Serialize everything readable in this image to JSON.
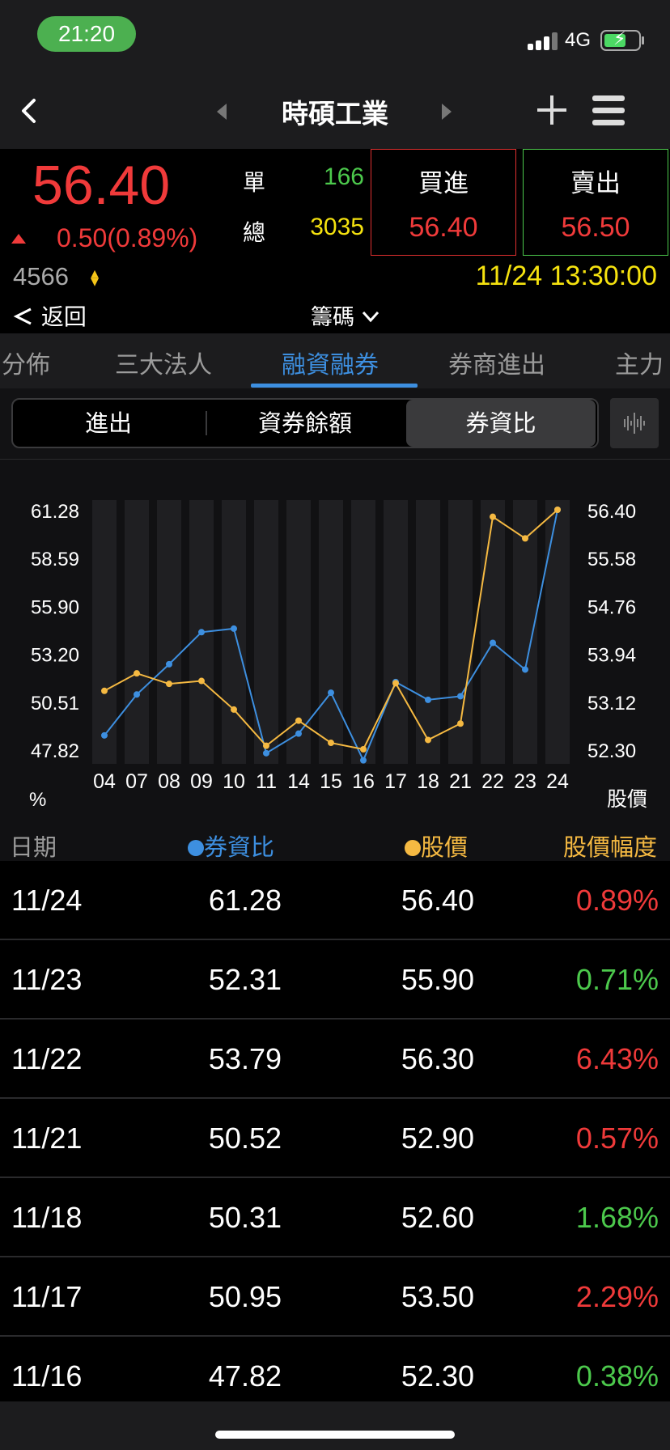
{
  "status_bar": {
    "time": "21:20",
    "network": "4G"
  },
  "nav": {
    "title": "時碩工業"
  },
  "quote": {
    "price": "56.40",
    "change": "0.50",
    "change_pct": "(0.89%)",
    "single_label": "單",
    "single_value": "166",
    "total_label": "總",
    "total_value": "3035",
    "bid_label": "買進",
    "bid_price": "56.40",
    "ask_label": "賣出",
    "ask_price": "56.50",
    "code": "4566",
    "datetime": "11/24 13:30:00",
    "back_label": "返回",
    "chips_label": "籌碼"
  },
  "colors": {
    "up": "#f03a3a",
    "down": "#4cc94c",
    "accent": "#3d8fe0",
    "orange": "#f5b942",
    "yellow": "#f5e20f",
    "green_box": "#4cc94c"
  },
  "tabs": [
    "分佈",
    "三大法人",
    "融資融券",
    "券商進出",
    "主力"
  ],
  "active_tab": 2,
  "segments": [
    "進出",
    "資券餘額",
    "券資比"
  ],
  "active_segment": 2,
  "chart_data": {
    "type": "line",
    "categories": [
      "04",
      "07",
      "08",
      "09",
      "10",
      "11",
      "14",
      "15",
      "16",
      "17",
      "18",
      "21",
      "22",
      "23",
      "24"
    ],
    "series": [
      {
        "name": "券資比",
        "axis": "left",
        "color": "#3d8fe0",
        "values": [
          48.6,
          50.9,
          52.6,
          54.4,
          54.6,
          47.6,
          48.7,
          51.0,
          47.2,
          51.6,
          50.6,
          50.8,
          53.8,
          52.3,
          61.28
        ]
      },
      {
        "name": "股價",
        "axis": "right",
        "color": "#f5b942",
        "values": [
          53.3,
          53.6,
          53.42,
          53.47,
          52.98,
          52.36,
          52.79,
          52.41,
          52.3,
          53.43,
          52.46,
          52.74,
          56.28,
          55.91,
          56.4
        ]
      }
    ],
    "y_left_ticks": [
      "61.28",
      "58.59",
      "55.90",
      "53.20",
      "50.51",
      "47.82"
    ],
    "y_right_ticks": [
      "56.40",
      "55.58",
      "54.76",
      "53.94",
      "53.12",
      "52.30"
    ],
    "ylim_left": [
      47.82,
      61.28
    ],
    "ylim_right": [
      52.3,
      56.4
    ],
    "y_left_unit": "%",
    "y_right_unit": "股價"
  },
  "table": {
    "headers": {
      "date": "日期",
      "ratio": "券資比",
      "price": "股價",
      "pct": "股價幅度"
    },
    "rows": [
      {
        "date": "11/24",
        "ratio": "61.28",
        "price": "56.40",
        "pct": "0.89%",
        "dir": "up"
      },
      {
        "date": "11/23",
        "ratio": "52.31",
        "price": "55.90",
        "pct": "0.71%",
        "dir": "down"
      },
      {
        "date": "11/22",
        "ratio": "53.79",
        "price": "56.30",
        "pct": "6.43%",
        "dir": "up"
      },
      {
        "date": "11/21",
        "ratio": "50.52",
        "price": "52.90",
        "pct": "0.57%",
        "dir": "up"
      },
      {
        "date": "11/18",
        "ratio": "50.31",
        "price": "52.60",
        "pct": "1.68%",
        "dir": "down"
      },
      {
        "date": "11/17",
        "ratio": "50.95",
        "price": "53.50",
        "pct": "2.29%",
        "dir": "up"
      },
      {
        "date": "11/16",
        "ratio": "47.82",
        "price": "52.30",
        "pct": "0.38%",
        "dir": "down"
      }
    ]
  }
}
